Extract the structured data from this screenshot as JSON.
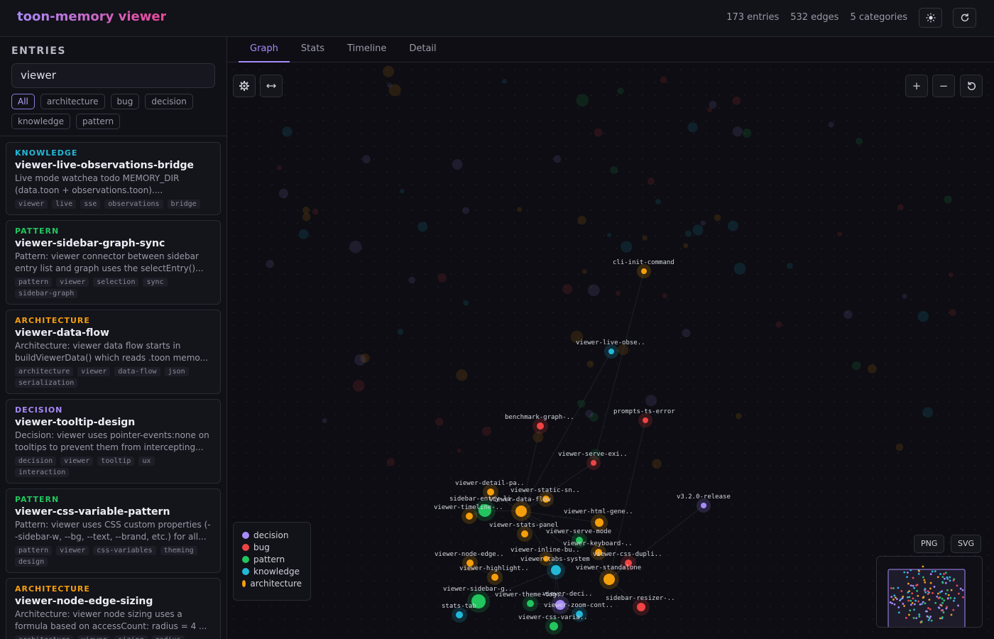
{
  "app": {
    "title": "toon-memory viewer"
  },
  "header": {
    "entries": "173 entries",
    "edges": "532 edges",
    "categories": "5 categories",
    "theme_icon": "sun-icon",
    "refresh_icon": "refresh-icon"
  },
  "sidebar": {
    "title": "ENTRIES",
    "search_value": "viewer",
    "filters": [
      "All",
      "architecture",
      "bug",
      "decision",
      "knowledge",
      "pattern"
    ],
    "entries": [
      {
        "category": "KNOWLEDGE",
        "color": "#22b8d8",
        "title": "viewer-live-observations-bridge",
        "desc": "Live mode watchea todo MEMORY_DIR (data.toon + observations.toon)....",
        "tags": [
          "viewer",
          "live",
          "sse",
          "observations",
          "bridge"
        ]
      },
      {
        "category": "PATTERN",
        "color": "#22c55e",
        "title": "viewer-sidebar-graph-sync",
        "desc": "Pattern: viewer connector between sidebar entry list and graph uses the selectEntry()...",
        "tags": [
          "pattern",
          "viewer",
          "selection",
          "sync",
          "sidebar-graph"
        ]
      },
      {
        "category": "ARCHITECTURE",
        "color": "#f59e0b",
        "title": "viewer-data-flow",
        "desc": "Architecture: viewer data flow starts in buildViewerData() which reads .toon memo...",
        "tags": [
          "architecture",
          "viewer",
          "data-flow",
          "json",
          "serialization"
        ]
      },
      {
        "category": "DECISION",
        "color": "#a78bfa",
        "title": "viewer-tooltip-design",
        "desc": "Decision: viewer uses pointer-events:none on tooltips to prevent them from intercepting...",
        "tags": [
          "decision",
          "viewer",
          "tooltip",
          "ux",
          "interaction"
        ]
      },
      {
        "category": "PATTERN",
        "color": "#22c55e",
        "title": "viewer-css-variable-pattern",
        "desc": "Pattern: viewer uses CSS custom properties (--sidebar-w, --bg, --text, --brand, etc.) for all...",
        "tags": [
          "pattern",
          "viewer",
          "css-variables",
          "theming",
          "design"
        ]
      },
      {
        "category": "ARCHITECTURE",
        "color": "#f59e0b",
        "title": "viewer-node-edge-sizing",
        "desc": "Architecture: viewer node sizing uses a formula based on accessCount: radius = 4 ...",
        "tags": [
          "architecture",
          "viewer",
          "sizing",
          "radius"
        ]
      }
    ]
  },
  "tabs": [
    "Graph",
    "Stats",
    "Timeline",
    "Detail"
  ],
  "graph": {
    "controls": {
      "settings_icon": "gear-icon",
      "fit_icon": "fit-width-icon",
      "zoom_in": "+",
      "zoom_out": "−",
      "reset_icon": "reset-icon"
    },
    "legend": [
      {
        "label": "decision",
        "color": "#a78bfa"
      },
      {
        "label": "bug",
        "color": "#ef4444"
      },
      {
        "label": "pattern",
        "color": "#22c55e"
      },
      {
        "label": "knowledge",
        "color": "#22b8d8"
      },
      {
        "label": "architecture",
        "color": "#f59e0b"
      }
    ],
    "export": [
      "PNG",
      "SVG"
    ],
    "nodes": [
      {
        "label": "cli-init-command",
        "cat": "architecture"
      },
      {
        "label": "viewer-live-obse..",
        "cat": "knowledge"
      },
      {
        "label": "benchmark-graph-..",
        "cat": "bug"
      },
      {
        "label": "prompts-ts-error",
        "cat": "bug"
      },
      {
        "label": "viewer-serve-exi..",
        "cat": "bug"
      },
      {
        "label": "viewer-detail-pa..",
        "cat": "architecture"
      },
      {
        "label": "viewer-static-sn..",
        "cat": "architecture"
      },
      {
        "label": "sidebar-entry-li..",
        "cat": "pattern"
      },
      {
        "label": "viewer-data-flow",
        "cat": "architecture"
      },
      {
        "label": "viewer-timeline-..",
        "cat": "architecture"
      },
      {
        "label": "v3.2.0-release",
        "cat": "decision"
      },
      {
        "label": "viewer-html-gene..",
        "cat": "architecture"
      },
      {
        "label": "viewer-stats-panel",
        "cat": "architecture"
      },
      {
        "label": "viewer-serve-mode",
        "cat": "pattern"
      },
      {
        "label": "viewer-keyboard-..",
        "cat": "architecture"
      },
      {
        "label": "viewer-inline-bu..",
        "cat": "architecture"
      },
      {
        "label": "viewer-css-dupli..",
        "cat": "bug"
      },
      {
        "label": "viewer-node-edge..",
        "cat": "architecture"
      },
      {
        "label": "viewer-tabs-system",
        "cat": "knowledge"
      },
      {
        "label": "viewer-highlight..",
        "cat": "architecture"
      },
      {
        "label": "viewer-standalone",
        "cat": "architecture"
      },
      {
        "label": "viewer-sidebar-g..",
        "cat": "pattern"
      },
      {
        "label": "viewer-theme-tog..",
        "cat": "pattern"
      },
      {
        "label": "viewer-deci..",
        "cat": "decision"
      },
      {
        "label": "sidebar-resizer-..",
        "cat": "bug"
      },
      {
        "label": "stats-tab",
        "cat": "knowledge"
      },
      {
        "label": "viewer-zoom-cont..",
        "cat": "knowledge"
      },
      {
        "label": "viewer-css-varia..",
        "cat": "pattern"
      }
    ]
  }
}
